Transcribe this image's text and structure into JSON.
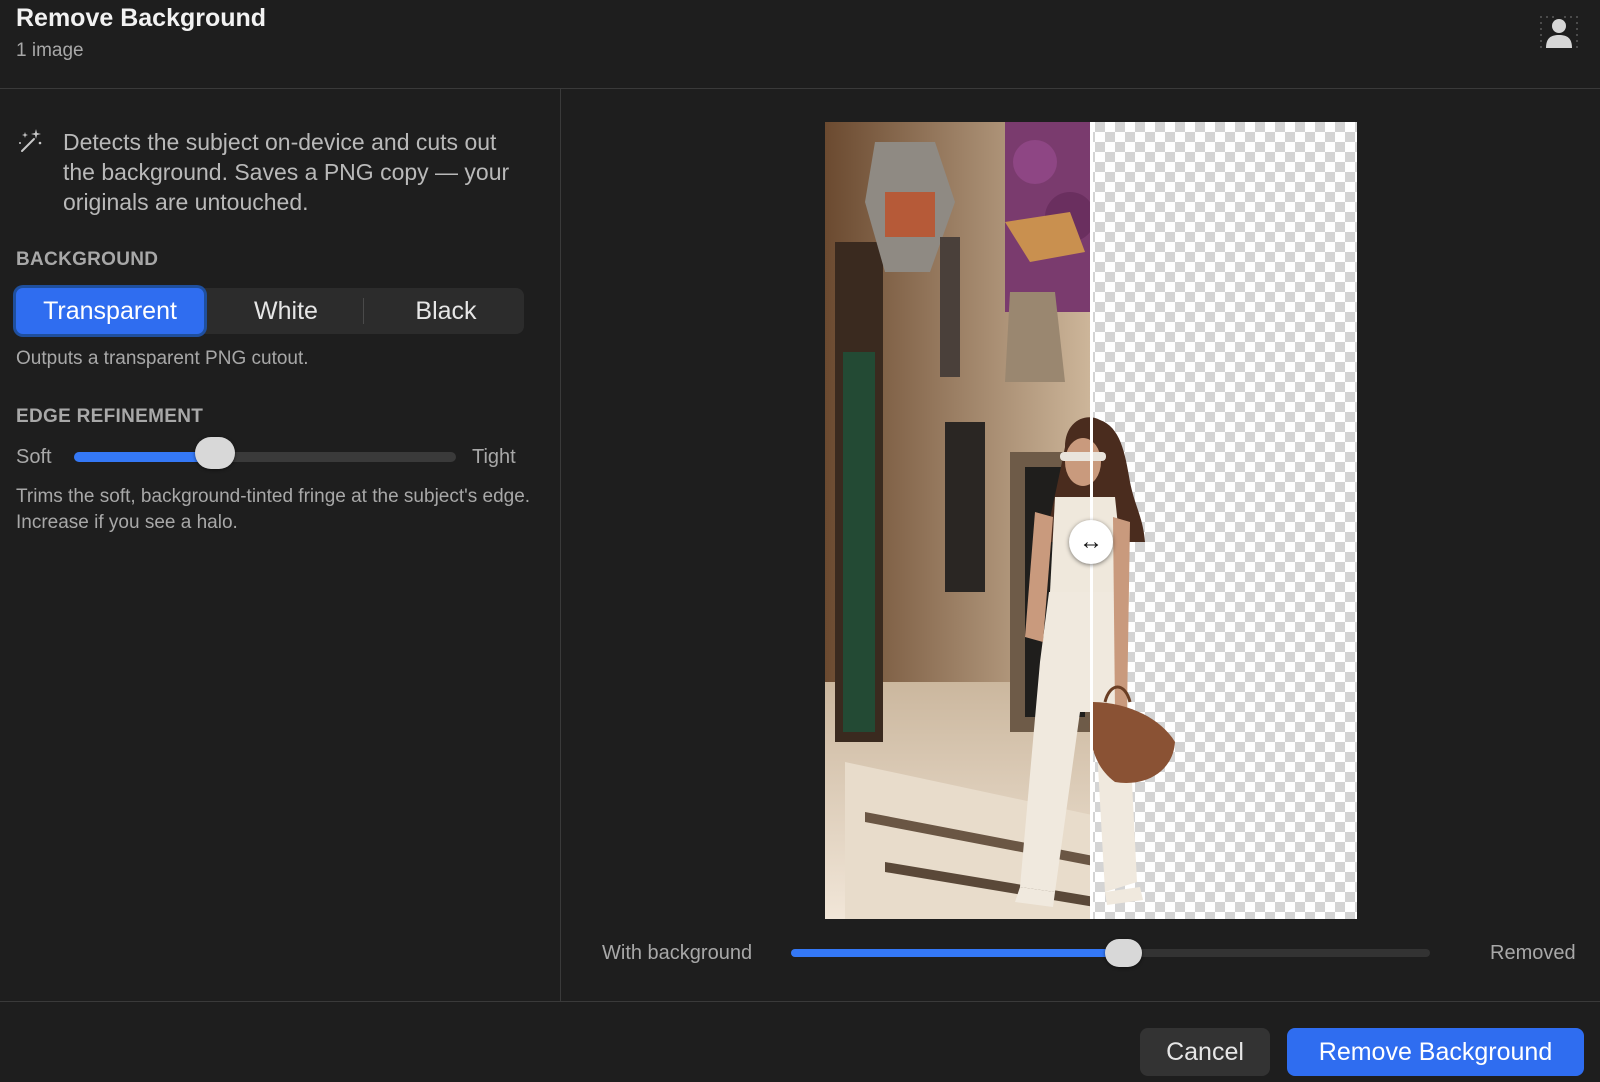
{
  "header": {
    "title": "Remove Background",
    "subtitle": "1 image",
    "icon": "person-silhouette-icon"
  },
  "left_panel": {
    "icon": "magic-wand-icon",
    "description": "Detects the subject on-device and cuts out the background. Saves a PNG copy — your originals are untouched.",
    "background_section": {
      "label": "BACKGROUND",
      "options": [
        "Transparent",
        "White",
        "Black"
      ],
      "selected": "Transparent",
      "hint": "Outputs a transparent PNG cutout."
    },
    "edge_section": {
      "label": "EDGE REFINEMENT",
      "min_label": "Soft",
      "max_label": "Tight",
      "value": 0.37,
      "hint": "Trims the soft, background-tinted fringe at the subject's edge. Increase if you see a halo."
    }
  },
  "preview": {
    "handle_glyph": "↔",
    "split_fraction": 0.5,
    "compare_slider": {
      "left_label": "With background",
      "right_label": "Removed",
      "value": 0.52
    }
  },
  "footer": {
    "cancel_label": "Cancel",
    "primary_label": "Remove Background"
  },
  "colors": {
    "accent": "#2f6df0",
    "background": "#1e1e1e",
    "panel_control": "#2c2c2c"
  }
}
